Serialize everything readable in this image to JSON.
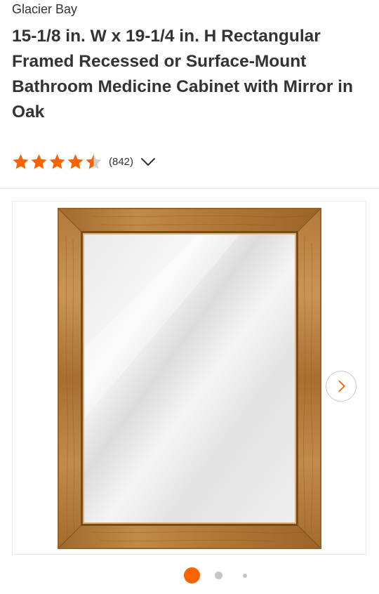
{
  "product": {
    "brand": "Glacier Bay",
    "title": "15-1/8 in. W x 19-1/4 in. H Rectangular Framed Recessed or Surface-Mount Bathroom Medicine Cabinet with Mirror in Oak",
    "rating": {
      "stars_filled": 4.5,
      "stars_max": 5,
      "review_count": "(842)",
      "star_color": "#f96302"
    }
  },
  "gallery": {
    "image_subject": "oak-framed-mirror-medicine-cabinet",
    "next_icon": "chevron-right-icon",
    "dots": {
      "count": 3,
      "active_index": 0,
      "active_color": "#f96302",
      "inactive_color": "#c6c6c6"
    }
  },
  "icons": {
    "expand_reviews": "chevron-down-icon"
  }
}
